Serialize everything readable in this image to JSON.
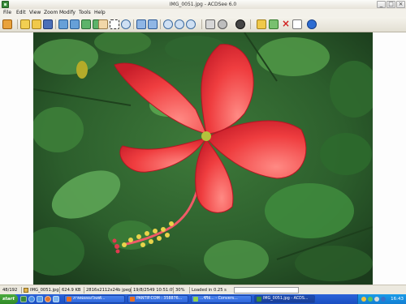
{
  "window": {
    "title": "IMG_0051.jpg - ACDSee 6.0",
    "buttons": [
      "_",
      "□",
      "×"
    ]
  },
  "menu": [
    "File",
    "Edit",
    "View",
    "Zoom",
    "Modify",
    "Tools",
    "Help"
  ],
  "toolbar": {
    "icons": [
      "browse-icon",
      "open-folder-icon",
      "folder-icon",
      "save-icon",
      "prev-image-icon",
      "next-image-icon",
      "prev-page-icon",
      "next-page-icon",
      "hand-icon",
      "select-icon",
      "zoom-icon",
      "fit-window-icon",
      "full-screen-icon",
      "zoom-in-icon",
      "zoom-out-icon",
      "zoom-menu-icon",
      "print-icon",
      "acquire-icon",
      "slideshow-icon",
      "rotate-icon",
      "move-to-icon",
      "copy-to-icon",
      "delete-icon",
      "properties-icon",
      "help-icon"
    ]
  },
  "status": {
    "index": "48/192",
    "filename": "IMG_0051.jpg",
    "filesize": "624.9 KB",
    "dimensions": "2816x2112x24b jpeg",
    "datetime": "19/8/2549 10:51:09",
    "zoom": "30%",
    "load_time": "Loaded in 0.25 s"
  },
  "taskbar": {
    "start": "start",
    "tasks": [
      "ภาพพ่อลองโพสต์...",
      "PANTIP.COM : 358876...",
      "...ซีรีย์... - Convers...",
      "IMG_0051.jpg - ACDS..."
    ],
    "clock": "16:43"
  }
}
